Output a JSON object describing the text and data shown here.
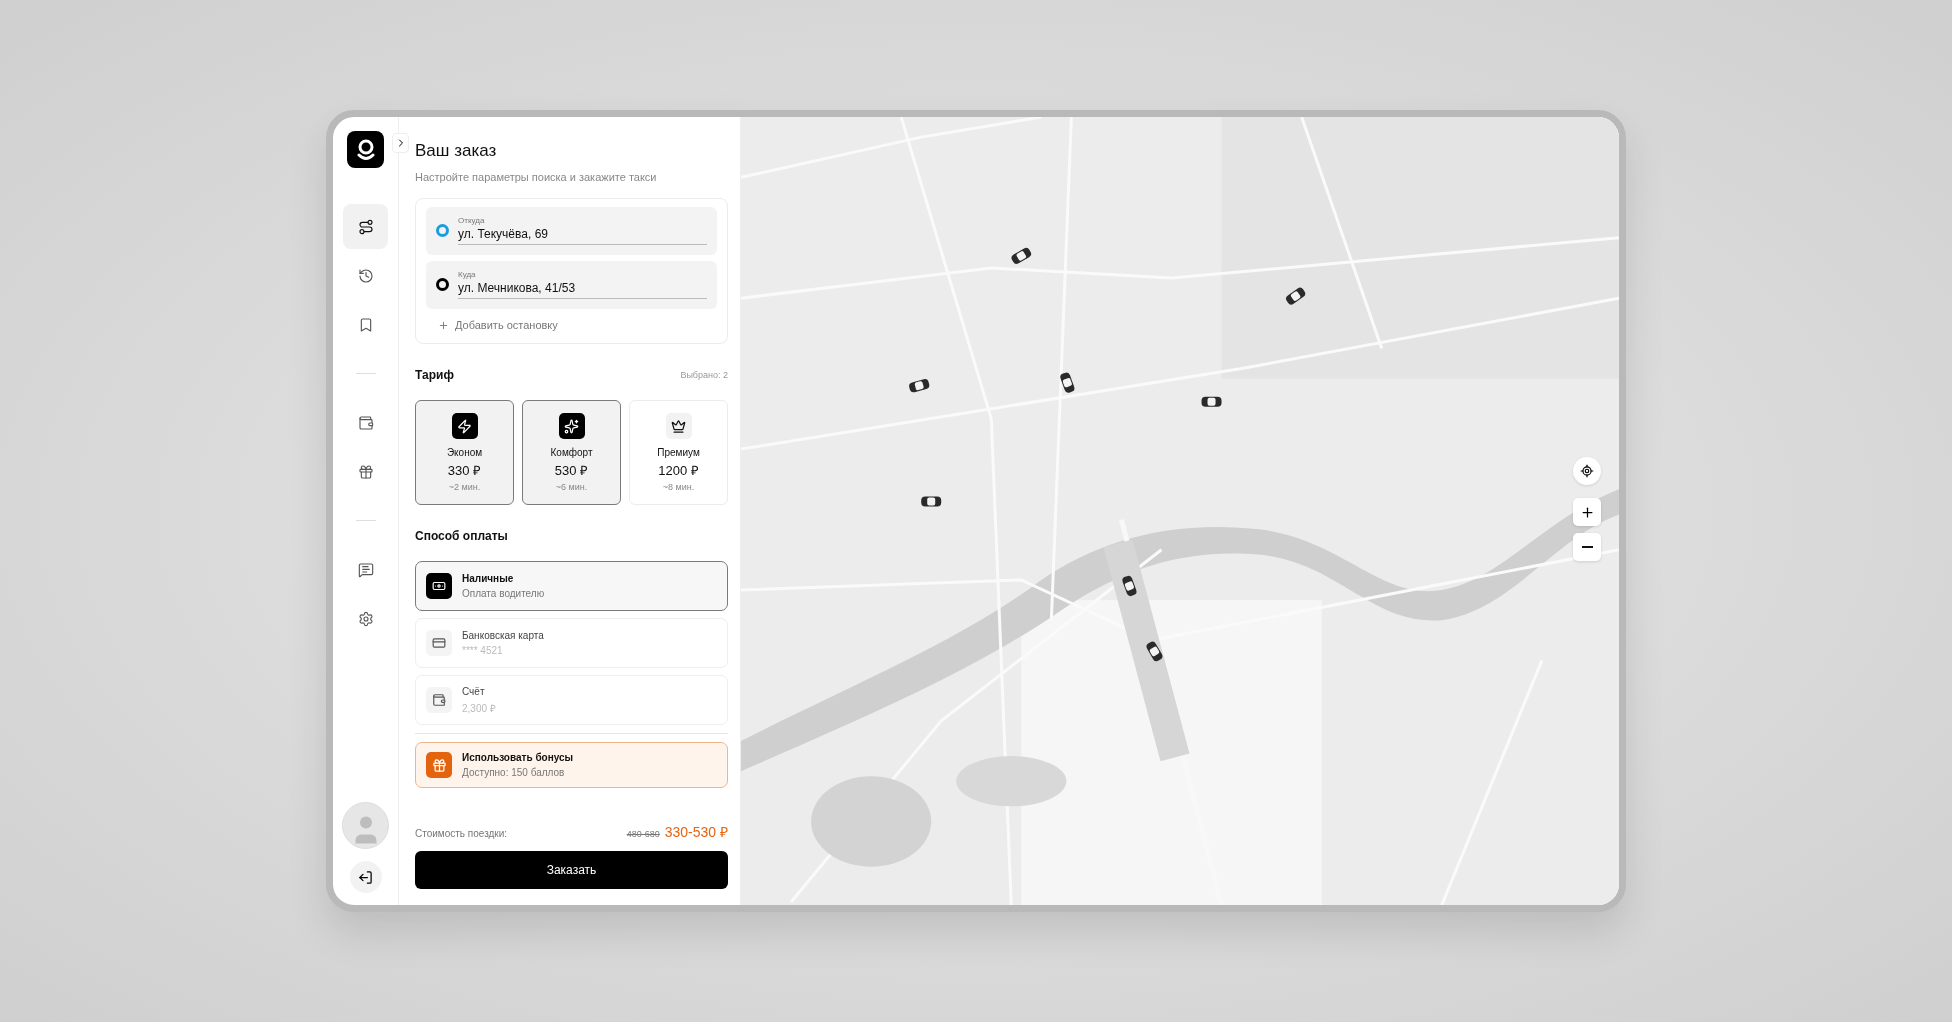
{
  "nav_groups": [
    [
      {
        "selected": true
      },
      {
        "selected": false
      },
      {
        "selected": false
      }
    ],
    [
      {
        "selected": false
      },
      {
        "selected": false
      }
    ],
    [
      {
        "selected": false
      },
      {
        "selected": false
      }
    ]
  ],
  "order": {
    "title": "Ваш заказ",
    "subtitle": "Настройте параметры поиска и закажите такси",
    "route": [
      {
        "kind": "origin",
        "label": "Откуда",
        "value": "ул. Текучёва, 69"
      },
      {
        "kind": "destination",
        "label": "Куда",
        "value": "ул. Мечникова, 41/53"
      }
    ],
    "add_stop": "Добавить остановку"
  },
  "tariff": {
    "title": "Тариф",
    "count": "Выбрано: 2",
    "options": [
      {
        "name": "Эконом",
        "price": "330 ₽",
        "eta": "~2 мин.",
        "selected": true
      },
      {
        "name": "Комфорт",
        "price": "530 ₽",
        "eta": "~6 мин.",
        "selected": true
      },
      {
        "name": "Премиум",
        "price": "1200 ₽",
        "eta": "~8 мин.",
        "selected": false
      }
    ]
  },
  "payment": {
    "title": "Способ оплаты",
    "methods": [
      {
        "name": "Наличные",
        "detail": "Оплата водителю",
        "selected": true
      },
      {
        "name": "Банковская карта",
        "detail": "**** 4521",
        "selected": false
      },
      {
        "name": "Счёт",
        "detail": "2,300 ₽",
        "selected": false
      }
    ],
    "bonus": {
      "name": "Использовать бонусы",
      "detail": "Доступно: 150 баллов",
      "on": true
    }
  },
  "cost": {
    "label": "Стоимость поездки:",
    "old_price": "480-680",
    "price": "330-530 ₽"
  },
  "order_button": "Заказать"
}
